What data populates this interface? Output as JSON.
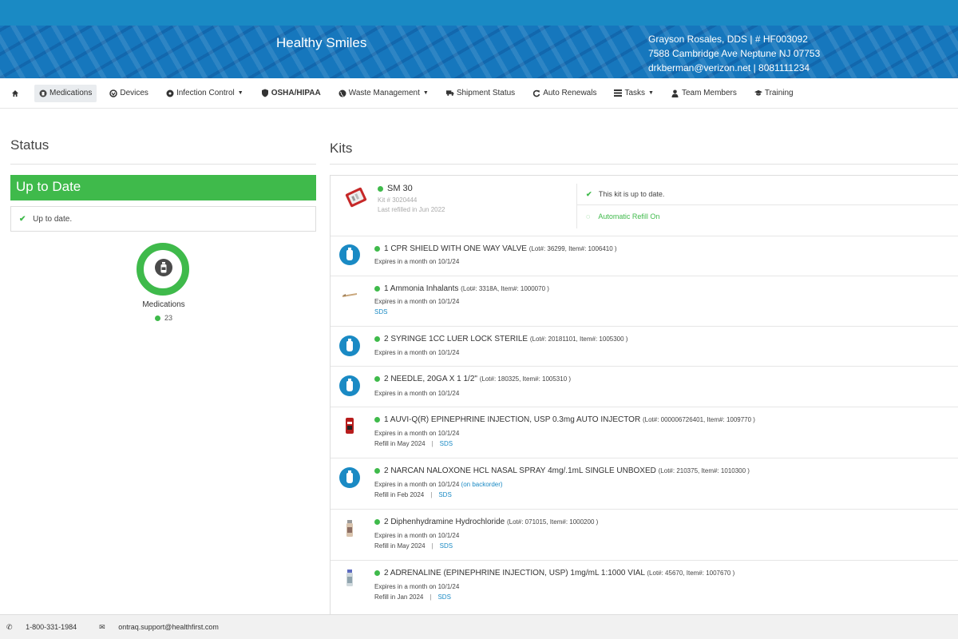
{
  "header": {
    "practice_name": "Healthy Smiles",
    "info_line1": "Grayson Rosales, DDS | # HF003092",
    "info_line2": "7588 Cambridge Ave Neptune NJ 07753",
    "info_line3": "drkberman@verizon.net | 8081111234"
  },
  "nav": {
    "medications": "Medications",
    "devices": "Devices",
    "infection_control": "Infection Control",
    "osha_hipaa": "OSHA/HIPAA",
    "waste_management": "Waste Management",
    "shipment_status": "Shipment Status",
    "auto_renewals": "Auto Renewals",
    "tasks": "Tasks",
    "team_members": "Team Members",
    "training": "Training"
  },
  "status": {
    "title": "Status",
    "state": "Up to Date",
    "detail": "Up to date.",
    "donut_label": "Medications",
    "donut_count": "23"
  },
  "kits": {
    "title": "Kits",
    "kit_name": "SM 30",
    "kit_number": "Kit # 3020444",
    "kit_refill": "Last refilled in Jun 2022",
    "kit_status": "This kit is up to date.",
    "kit_auto_refill": "Automatic Refill On"
  },
  "items": [
    {
      "title": "1 CPR SHIELD WITH ONE WAY VALVE",
      "lot": "(Lot#: 36299, Item#: 1006410 )",
      "expires": "Expires in a month on 10/1/24"
    },
    {
      "title": "1 Ammonia Inhalants",
      "lot": "(Lot#: 3318A, Item#: 1000070 )",
      "expires": "Expires in a month on 10/1/24",
      "sds": "SDS"
    },
    {
      "title": "2 SYRINGE 1CC LUER LOCK STERILE",
      "lot": "(Lot#: 20181101, Item#: 1005300 )",
      "expires": "Expires in a month on 10/1/24"
    },
    {
      "title": "2 NEEDLE, 20GA X 1 1/2\"",
      "lot": "(Lot#: 180325, Item#: 1005310 )",
      "expires": "Expires in a month on 10/1/24"
    },
    {
      "title": "1 AUVI-Q(R) EPINEPHRINE INJECTION, USP 0.3mg AUTO INJECTOR",
      "lot": "(Lot#: 000006726401, Item#: 1009770 )",
      "expires": "Expires in a month on 10/1/24",
      "refill": "Refill in May 2024",
      "sds": "SDS"
    },
    {
      "title": "2 NARCAN NALOXONE HCL NASAL SPRAY 4mg/.1mL SINGLE UNBOXED",
      "lot": "(Lot#: 210375, Item#: 1010300 )",
      "expires": "Expires in a month on 10/1/24",
      "backorder": "(on backorder)",
      "refill": "Refill in Feb 2024",
      "sds": "SDS"
    },
    {
      "title": "2 Diphenhydramine Hydrochloride",
      "lot": "(Lot#: 071015, Item#: 1000200 )",
      "expires": "Expires in a month on 10/1/24",
      "refill": "Refill in May 2024",
      "sds": "SDS"
    },
    {
      "title": "2 ADRENALINE (EPINEPHRINE INJECTION, USP) 1mg/mL 1:1000 VIAL",
      "lot": "(Lot#: 45670, Item#: 1007670 )",
      "expires": "Expires in a month on 10/1/24",
      "refill": "Refill in Jan 2024",
      "sds": "SDS"
    }
  ],
  "footer": {
    "phone": "1-800-331-1984",
    "email": "ontraq.support@healthfirst.com"
  },
  "colors": {
    "brand_blue": "#1a8ac4",
    "status_green": "#3fba4b"
  }
}
